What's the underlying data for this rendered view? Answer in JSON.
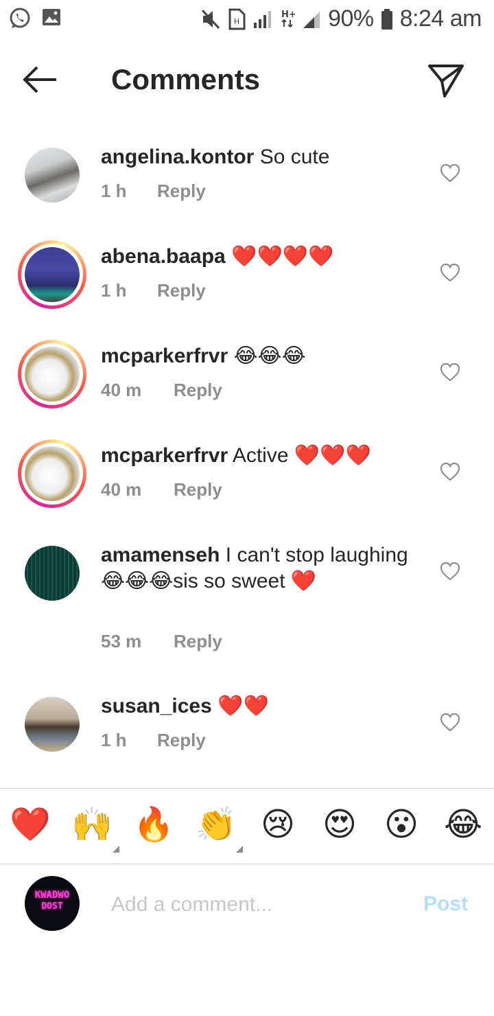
{
  "status_bar": {
    "battery_percent": "90%",
    "clock": "8:24 am",
    "icons": [
      "whatsapp-icon",
      "gallery-icon",
      "mute-icon",
      "sim-icon",
      "signal-icon",
      "hplus-icon",
      "battery-icon"
    ]
  },
  "header": {
    "title": "Comments",
    "back_icon": "arrow-left-icon",
    "send_icon": "paper-plane-icon"
  },
  "comments": [
    {
      "username": "angelina.kontor",
      "text": "So cute",
      "time": "1 h",
      "reply": "Reply",
      "story_ring": false
    },
    {
      "username": "abena.baapa",
      "text": "❤️❤️❤️❤️",
      "time": "1 h",
      "reply": "Reply",
      "story_ring": true
    },
    {
      "username": "mcparkerfrvr",
      "text": "😂😂😂",
      "time": "40 m",
      "reply": "Reply",
      "story_ring": true
    },
    {
      "username": "mcparkerfrvr",
      "text": "Active ❤️❤️❤️",
      "time": "40 m",
      "reply": "Reply",
      "story_ring": true
    },
    {
      "username": "amamenseh",
      "text": "I can't stop laughing 😂😂😂sis so sweet ❤️",
      "time": "53 m",
      "reply": "Reply",
      "story_ring": false
    },
    {
      "username": "susan_ices",
      "text": "❤️❤️",
      "time": "1 h",
      "reply": "Reply",
      "story_ring": false
    }
  ],
  "quick_emojis": [
    "❤️",
    "🙌",
    "🔥",
    "👏",
    "😢",
    "😍",
    "😮",
    "😂"
  ],
  "composer": {
    "avatar_text_line1": "KWADWO",
    "avatar_text_line2": "DOST",
    "placeholder": "Add a comment...",
    "post_label": "Post"
  },
  "colors": {
    "text": "#262626",
    "secondary": "#8e8e8e",
    "post_disabled": "#b2dffc",
    "heart": "#ed1c24"
  }
}
